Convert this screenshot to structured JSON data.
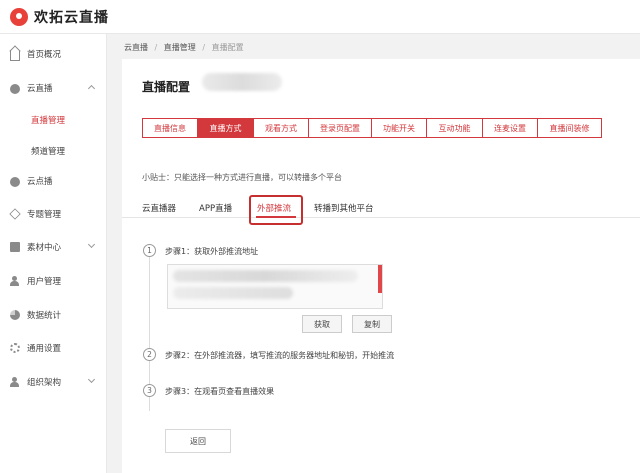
{
  "app": {
    "name": "欢拓云直播"
  },
  "sidebar": {
    "items": [
      {
        "label": "首页概况",
        "icon": "home-icon"
      },
      {
        "label": "云直播",
        "icon": "cloud-icon"
      },
      {
        "label": "云点播",
        "icon": "cloud-icon"
      },
      {
        "label": "专题管理",
        "icon": "layers-icon"
      },
      {
        "label": "素材中心",
        "icon": "folder-icon"
      },
      {
        "label": "用户管理",
        "icon": "user-icon"
      },
      {
        "label": "数据统计",
        "icon": "pie-chart-icon"
      },
      {
        "label": "通用设置",
        "icon": "gear-icon"
      },
      {
        "label": "组织架构",
        "icon": "org-icon"
      }
    ],
    "sub_items": [
      "直播管理",
      "频道管理"
    ]
  },
  "breadcrumb": [
    "云直播",
    "直播管理",
    "直播配置"
  ],
  "page": {
    "title": "直播配置"
  },
  "tabs": [
    "直播信息",
    "直播方式",
    "观看方式",
    "登录页配置",
    "功能开关",
    "互动功能",
    "连麦设置",
    "直播间装修"
  ],
  "tip": "小贴士：只能选择一种方式进行直播，可以转播多个平台",
  "subtabs": [
    "云直播器",
    "APP直播",
    "外部推流",
    "转播到其他平台"
  ],
  "steps": [
    {
      "num": "1",
      "text": "步骤1：获取外部推流地址"
    },
    {
      "num": "2",
      "text": "步骤2：在外部推流器，填写推流的服务器地址和秘钥，开始推流"
    },
    {
      "num": "3",
      "text": "步骤3：在观看页查看直播效果"
    }
  ],
  "buttons": {
    "get": "获取",
    "copy": "复制",
    "back": "返回"
  },
  "colors": {
    "accent": "#d3383c"
  }
}
